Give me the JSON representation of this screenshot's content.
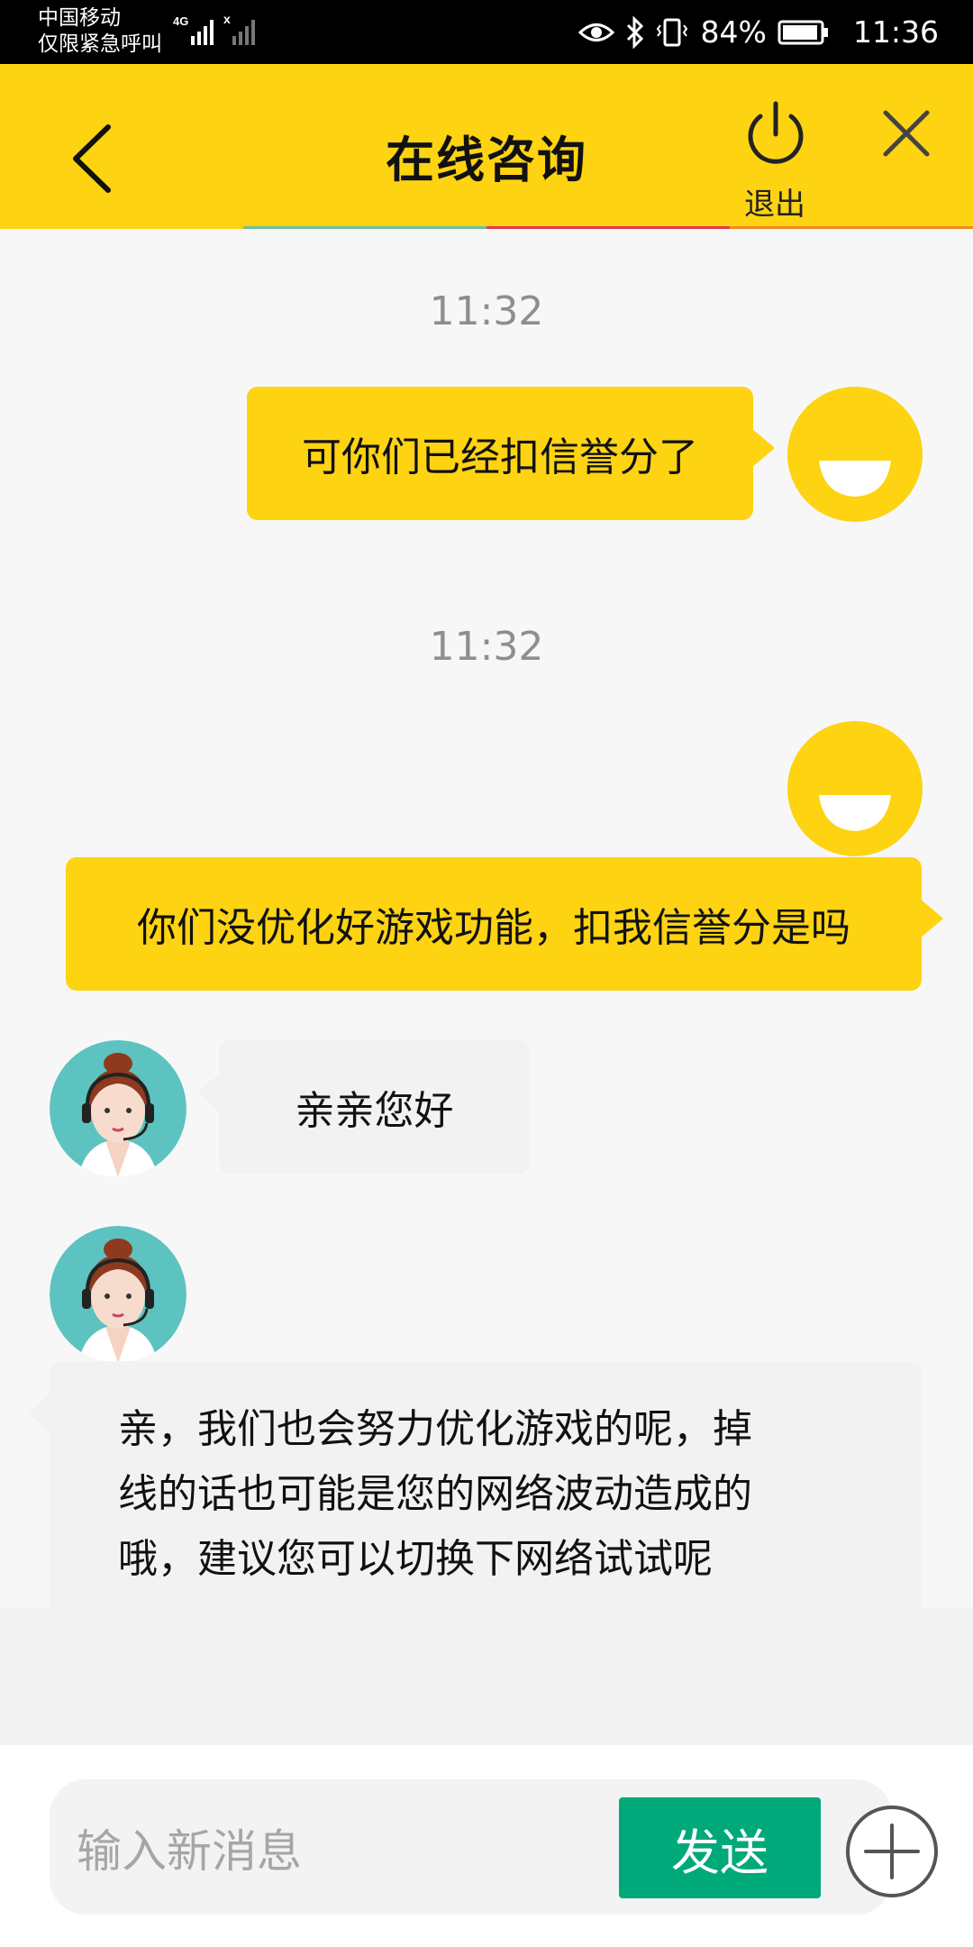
{
  "status_bar": {
    "carrier_line1": "中国移动",
    "carrier_line2": "仅限紧急呼叫",
    "battery": "84%",
    "time": "11:36",
    "icons": [
      "eye-icon",
      "bluetooth-icon",
      "vibrate-icon",
      "battery-icon"
    ]
  },
  "header": {
    "title": "在线咨询",
    "exit_label": "退出",
    "icons": [
      "back-icon",
      "power-icon",
      "close-icon"
    ],
    "bg_color": "#fdd312"
  },
  "messages": [
    {
      "type": "timestamp",
      "text": "11:32"
    },
    {
      "type": "user",
      "text": "可你们已经扣信誉分了"
    },
    {
      "type": "timestamp",
      "text": "11:32"
    },
    {
      "type": "user",
      "text": "你们没优化好游戏功能，扣我信誉分是吗"
    },
    {
      "type": "agent",
      "text": "亲亲您好"
    },
    {
      "type": "agent",
      "lines": [
        "亲，我们也会努力优化游戏的呢，掉",
        "线的话也可能是您的网络波动造成的",
        "哦，建议您可以切换下网络试试呢"
      ]
    }
  ],
  "input": {
    "placeholder": "输入新消息",
    "send_label": "发送",
    "send_color": "#00a97a"
  }
}
